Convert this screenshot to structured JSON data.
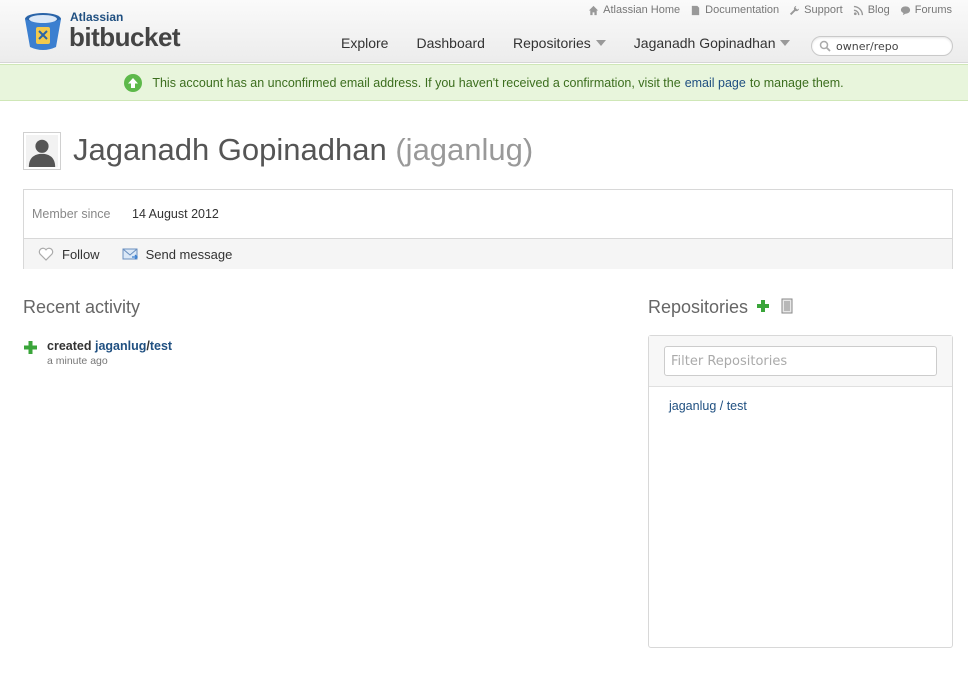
{
  "header": {
    "brand_small": "Atlassian",
    "brand_big": "bitbucket",
    "top_links": [
      "Atlassian Home",
      "Documentation",
      "Support",
      "Blog",
      "Forums"
    ],
    "nav": {
      "explore": "Explore",
      "dashboard": "Dashboard",
      "repositories": "Repositories",
      "user": "Jaganadh Gopinadhan"
    },
    "search": {
      "value": "owner/repo"
    }
  },
  "notice": {
    "text_before": "This account has an unconfirmed email address. If you haven't received a confirmation, visit the",
    "link": "email page",
    "text_after": "to manage them."
  },
  "profile": {
    "full_name": "Jaganadh Gopinadhan",
    "username": "(jaganlug)",
    "member_since_label": "Member since",
    "member_since_value": "14 August 2012",
    "follow_label": "Follow",
    "send_message_label": "Send message"
  },
  "activity": {
    "title": "Recent activity",
    "items": [
      {
        "verb": "created",
        "owner": "jaganlug",
        "sep": "/",
        "repo": "test",
        "time": "a minute ago"
      }
    ]
  },
  "repositories": {
    "title": "Repositories",
    "filter_placeholder": "Filter Repositories",
    "items": [
      {
        "owner": "jaganlug",
        "sep": " / ",
        "name": "test"
      }
    ]
  },
  "colors": {
    "link": "#205081",
    "notice_bg": "#e8f5dc",
    "notice_text": "#3c6e1e",
    "add_green": "#3aa53a"
  }
}
